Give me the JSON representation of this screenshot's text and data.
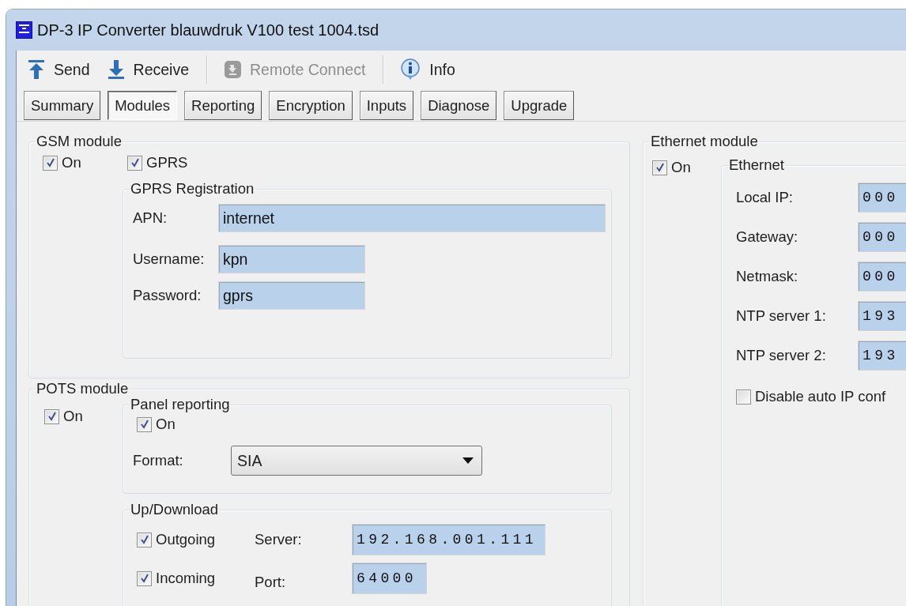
{
  "window": {
    "title": "DP-3 IP Converter blauwdruk V100 test 1004.tsd"
  },
  "toolbar": [
    {
      "label": "Send",
      "kind": "send",
      "disabled": false
    },
    {
      "label": "Receive",
      "kind": "receive",
      "disabled": false
    },
    {
      "label": "Remote Connect",
      "kind": "remote",
      "disabled": true
    },
    {
      "label": "Info",
      "kind": "info",
      "disabled": false
    }
  ],
  "tabs": [
    {
      "label": "Summary",
      "selected": false
    },
    {
      "label": "Modules",
      "selected": true
    },
    {
      "label": "Reporting",
      "selected": false
    },
    {
      "label": "Encryption",
      "selected": false
    },
    {
      "label": "Inputs",
      "selected": false
    },
    {
      "label": "Diagnose",
      "selected": false
    },
    {
      "label": "Upgrade",
      "selected": false
    }
  ],
  "gsm_module": {
    "title": "GSM module",
    "on": {
      "label": "On",
      "checked": true
    },
    "gprs": {
      "label": "GPRS",
      "checked": true
    },
    "registration": {
      "title": "GPRS Registration",
      "fields": [
        {
          "label": "APN:",
          "value": "internet",
          "kind": "wide"
        },
        {
          "label": "Username:",
          "value": "kpn",
          "kind": "short"
        },
        {
          "label": "Password:",
          "value": "gprs",
          "kind": "short"
        }
      ]
    }
  },
  "pots_module": {
    "title": "POTS module",
    "on": {
      "label": "On",
      "checked": true
    },
    "panel_reporting": {
      "title": "Panel reporting",
      "on": {
        "label": "On",
        "checked": true
      },
      "format": {
        "label": "Format:",
        "value": "SIA"
      }
    },
    "up_download": {
      "title": "Up/Download",
      "rows": [
        {
          "option": {
            "label": "Outgoing",
            "checked": true
          },
          "label": "Server:",
          "value": "192.168.001.111"
        },
        {
          "option": {
            "label": "Incoming",
            "checked": true
          },
          "label": "Port:",
          "value": "64000"
        }
      ]
    }
  },
  "ethernet_module": {
    "title": "Ethernet module",
    "on": {
      "label": "On",
      "checked": true
    },
    "ethernet": {
      "title": "Ethernet",
      "fields": [
        {
          "label": "Local IP:",
          "value": "000"
        },
        {
          "label": "Gateway:",
          "value": "000"
        },
        {
          "label": "Netmask:",
          "value": "000"
        },
        {
          "label": "NTP server 1:",
          "value": "193"
        },
        {
          "label": "NTP server 2:",
          "value": "193"
        }
      ],
      "disable_auto_ip": {
        "label": "Disable auto IP conf",
        "checked": false
      }
    }
  }
}
